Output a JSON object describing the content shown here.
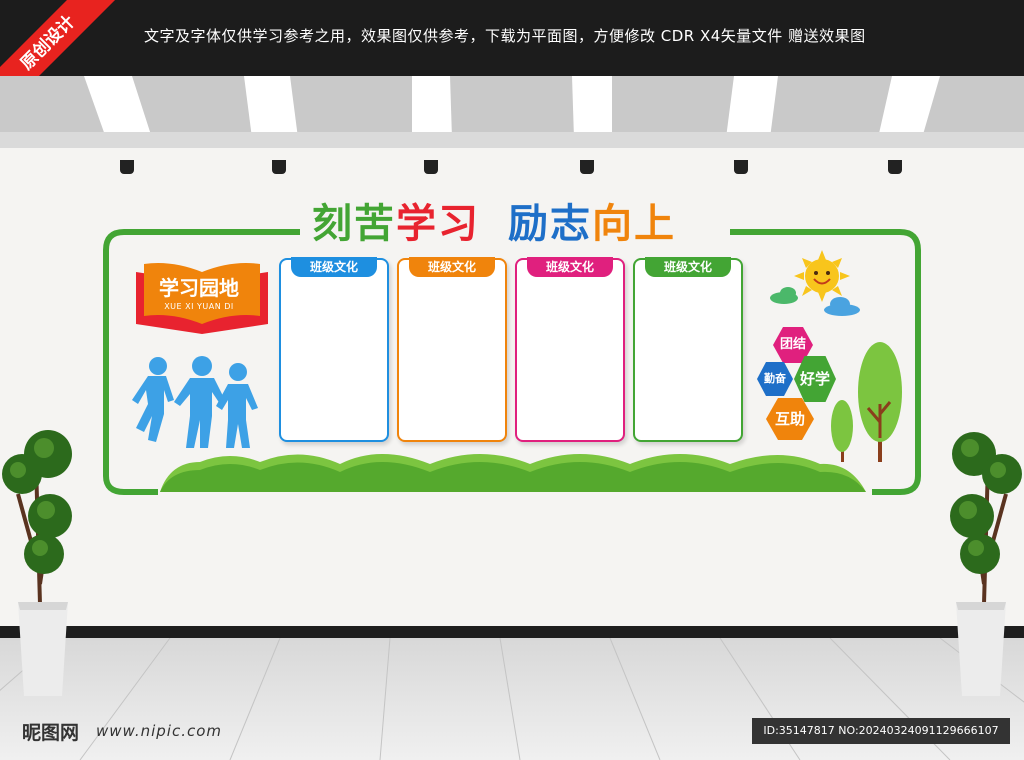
{
  "top_notice": "文字及字体仅供学习参考之用，效果图仅供参考，下载为平面图，方便修改    CDR X4矢量文件  赠送效果图",
  "corner_ribbon": "原创设计",
  "headline": {
    "part1": "刻苦",
    "part2": "学习",
    "part3": "励志",
    "part4": "向上"
  },
  "garden_badge": {
    "title": "学习园地",
    "subtitle": "XUE XI YUAN DI"
  },
  "panels": [
    {
      "label": "班级文化",
      "color": "#1e8fe0"
    },
    {
      "label": "班级文化",
      "color": "#f0840c"
    },
    {
      "label": "班级文化",
      "color": "#e0207e"
    },
    {
      "label": "班级文化",
      "color": "#43a534"
    }
  ],
  "hexagons": [
    {
      "label": "团结",
      "color": "#e0207e"
    },
    {
      "label": "勤奋",
      "color": "#1e6fc8"
    },
    {
      "label": "好学",
      "color": "#43a534"
    },
    {
      "label": "互助",
      "color": "#f0840c"
    }
  ],
  "watermark": {
    "site_name": "昵图网",
    "site_url": "www.nipic.com",
    "id_text": "ID:35147817 NO:20240324091129666107"
  },
  "colors": {
    "frame_green": "#43a534",
    "frame_blue": "#1e6fc8"
  }
}
